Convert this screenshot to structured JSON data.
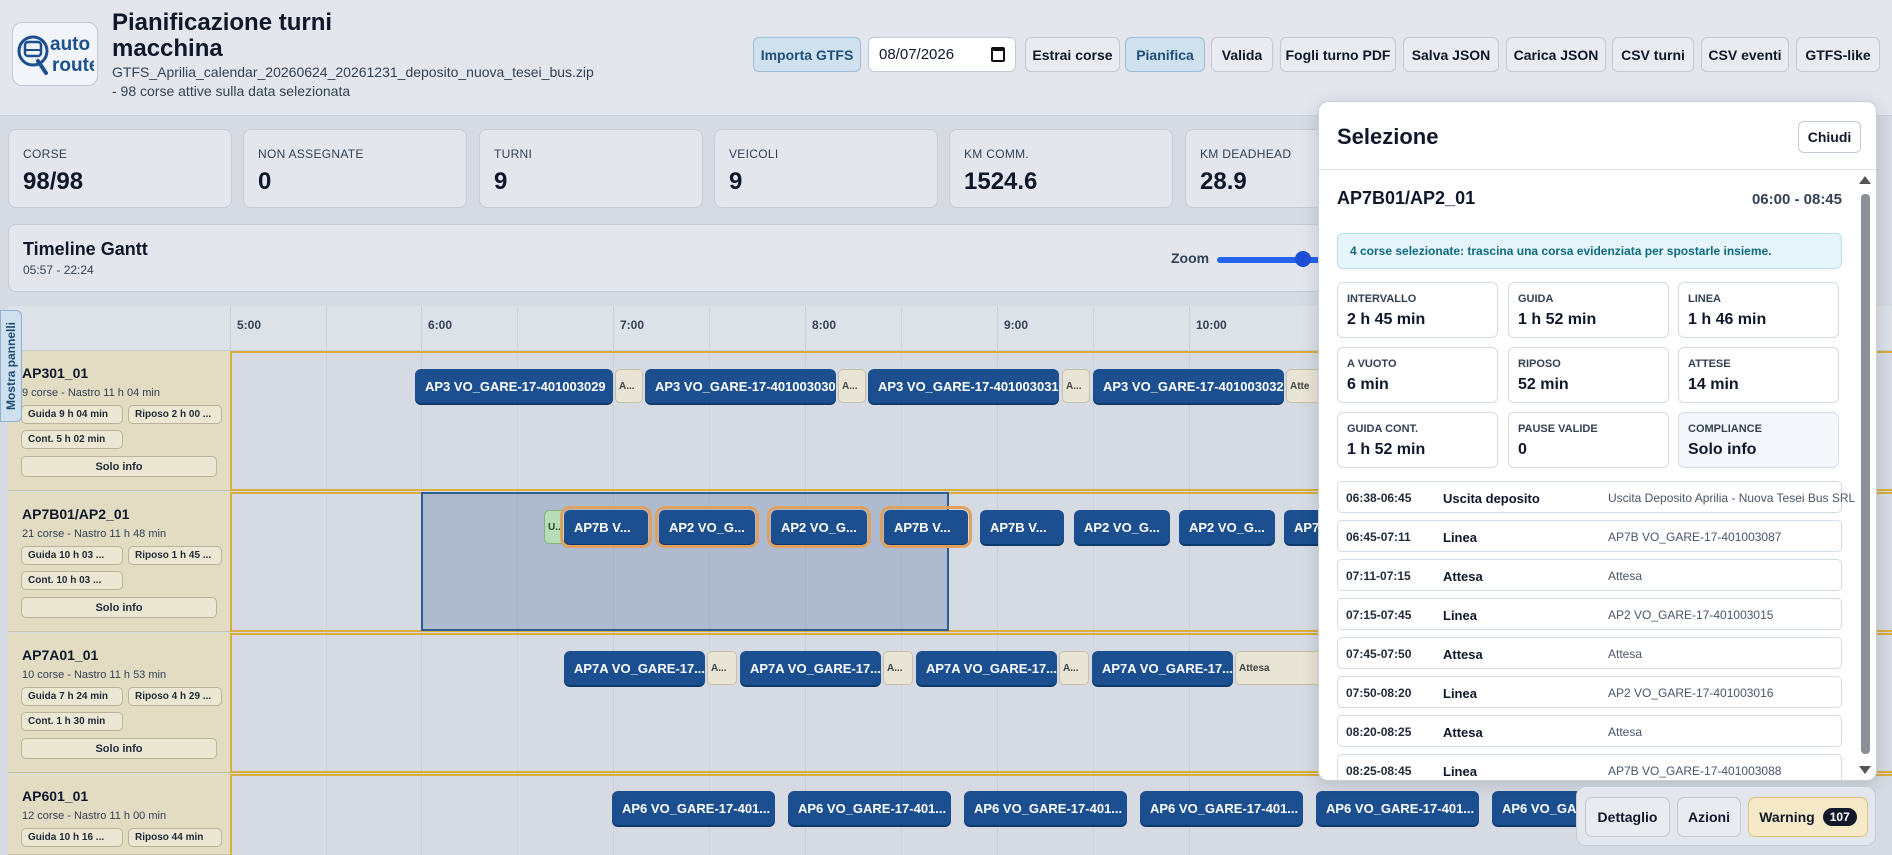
{
  "app": {
    "title": "Pianificazione turni macchina",
    "file": "GTFS_Aprilia_calendar_20260624_20261231_deposito_nuova_tesei_bus.zip",
    "active_runs": "- 98 corse attive sulla data selezionata",
    "logo_line1": "auto",
    "logo_line2": "route"
  },
  "toolbar": {
    "import": "Importa GTFS",
    "date": "08/07/2026",
    "extract": "Estrai corse",
    "plan": "Pianifica",
    "validate": "Valida",
    "pdf": "Fogli turno PDF",
    "save_json": "Salva JSON",
    "load_json": "Carica JSON",
    "csv_shifts": "CSV turni",
    "csv_events": "CSV eventi",
    "gtfs_like": "GTFS-like"
  },
  "stats": [
    {
      "label": "CORSE",
      "value": "98/98"
    },
    {
      "label": "NON ASSEGNATE",
      "value": "0"
    },
    {
      "label": "TURNI",
      "value": "9"
    },
    {
      "label": "VEICOLI",
      "value": "9"
    },
    {
      "label": "KM COMM.",
      "value": "1524.6"
    },
    {
      "label": "KM DEADHEAD",
      "value": "28.9"
    }
  ],
  "gantt": {
    "title": "Timeline Gantt",
    "range": "05:57 - 22:24",
    "zoom_label": "Zoom",
    "show_panels": "Mostra pannelli",
    "ticks": [
      "5:00",
      "6:00",
      "7:00",
      "8:00",
      "9:00",
      "10:00"
    ],
    "rows": [
      {
        "name": "AP301_01",
        "summary": "9 corse - Nastro 11 h 04 min",
        "chips": [
          "Guida 9 h 04 min",
          "Riposo 2 h 00 ...",
          "Cont. 5 h 02 min"
        ],
        "info": "Solo info",
        "blocks": [
          "AP3 VO_GARE-17-401003029",
          "AP3 VO_GARE-17-401003030",
          "AP3 VO_GARE-17-401003031",
          "AP3 VO_GARE-17-401003032"
        ],
        "gaps": [
          "A...",
          "A...",
          "A...",
          "Atte"
        ]
      },
      {
        "name": "AP7B01/AP2_01",
        "summary": "21 corse - Nastro 11 h 48 min",
        "chips": [
          "Guida 10 h 03 ...",
          "Riposo 1 h 45 ...",
          "Cont. 10 h 03 ..."
        ],
        "info": "Solo info",
        "blocks": [
          "AP7B V...",
          "AP2 VO_G...",
          "AP2 VO_G...",
          "AP7B V...",
          "AP7B V...",
          "AP2 VO_G...",
          "AP2 VO_G...",
          "AP7"
        ],
        "gaps": [
          "U..."
        ]
      },
      {
        "name": "AP7A01_01",
        "summary": "10 corse - Nastro 11 h 53 min",
        "chips": [
          "Guida 7 h 24 min",
          "Riposo 4 h 29 ...",
          "Cont. 1 h 30 min"
        ],
        "info": "Solo info",
        "blocks": [
          "AP7A VO_GARE-17...",
          "AP7A VO_GARE-17...",
          "AP7A VO_GARE-17...",
          "AP7A VO_GARE-17..."
        ],
        "gaps": [
          "A...",
          "A...",
          "A...",
          "Attesa"
        ]
      },
      {
        "name": "AP601_01",
        "summary": "12 corse - Nastro 11 h 00 min",
        "chips": [
          "Guida 10 h 16 ...",
          "Riposo 44 min"
        ],
        "info": "",
        "blocks": [
          "AP6 VO_GARE-17-401...",
          "AP6 VO_GARE-17-401...",
          "AP6 VO_GARE-17-401...",
          "AP6 VO_GARE-17-401...",
          "AP6 VO_GARE-17-401...",
          "AP6 VO_GAR"
        ],
        "gaps": []
      }
    ]
  },
  "selection": {
    "title": "Selezione",
    "close": "Chiudi",
    "name": "AP7B01/AP2_01",
    "time": "06:00 - 08:45",
    "message": "4 corse selezionate: trascina una corsa evidenziata per spostarle insieme.",
    "metrics": [
      {
        "label": "INTERVALLO",
        "value": "2 h 45 min"
      },
      {
        "label": "GUIDA",
        "value": "1 h 52 min"
      },
      {
        "label": "LINEA",
        "value": "1 h 46 min"
      },
      {
        "label": "A VUOTO",
        "value": "6 min"
      },
      {
        "label": "RIPOSO",
        "value": "52 min"
      },
      {
        "label": "ATTESE",
        "value": "14 min"
      },
      {
        "label": "GUIDA CONT.",
        "value": "1 h 52 min"
      },
      {
        "label": "PAUSE VALIDE",
        "value": "0"
      },
      {
        "label": "COMPLIANCE",
        "value": "Solo info"
      }
    ],
    "events": [
      {
        "time": "06:38-06:45",
        "kind": "Uscita deposito",
        "desc": "Uscita Deposito Aprilia - Nuova Tesei Bus SRL"
      },
      {
        "time": "06:45-07:11",
        "kind": "Linea",
        "desc": "AP7B VO_GARE-17-401003087"
      },
      {
        "time": "07:11-07:15",
        "kind": "Attesa",
        "desc": "Attesa"
      },
      {
        "time": "07:15-07:45",
        "kind": "Linea",
        "desc": "AP2 VO_GARE-17-401003015"
      },
      {
        "time": "07:45-07:50",
        "kind": "Attesa",
        "desc": "Attesa"
      },
      {
        "time": "07:50-08:20",
        "kind": "Linea",
        "desc": "AP2 VO_GARE-17-401003016"
      },
      {
        "time": "08:20-08:25",
        "kind": "Attesa",
        "desc": "Attesa"
      },
      {
        "time": "08:25-08:45",
        "kind": "Linea",
        "desc": "AP7B VO_GARE-17-401003088"
      }
    ]
  },
  "bottom": {
    "detail": "Dettaglio",
    "actions": "Azioni",
    "warning": "Warning",
    "warning_count": "107"
  },
  "colors": {
    "block": "#1b4f8f",
    "row_bg": "#e2dcc3",
    "row_border": "#d9ad3d",
    "accent": "#2563eb"
  }
}
